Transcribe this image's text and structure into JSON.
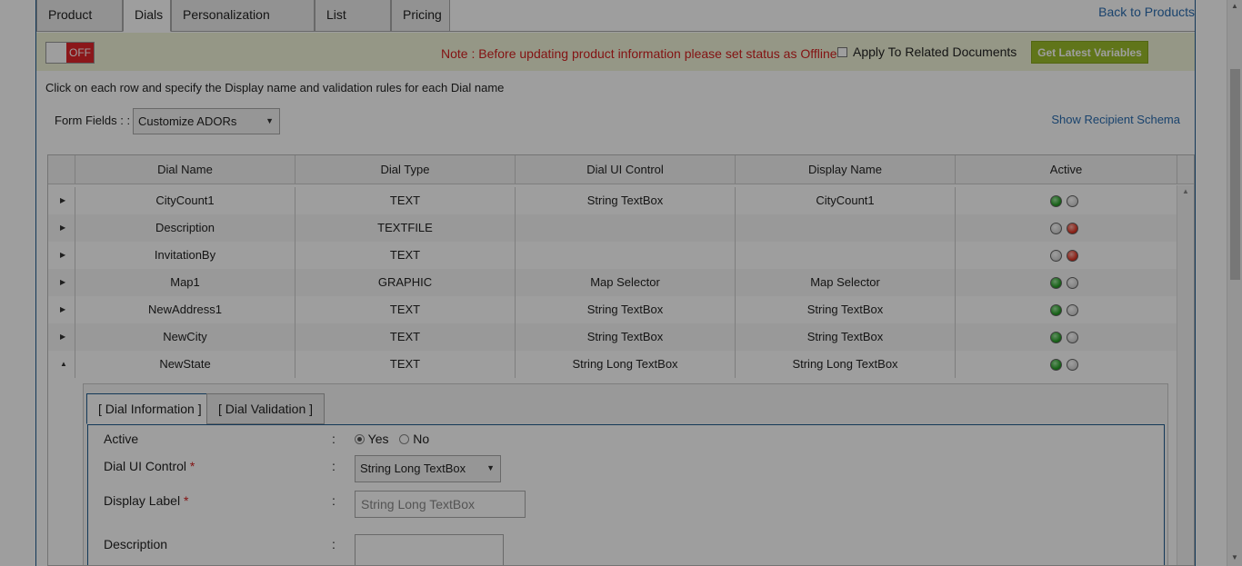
{
  "tabs": [
    {
      "label": "Product Info"
    },
    {
      "label": "Dials"
    },
    {
      "label": "Personalization Wizard"
    },
    {
      "label": "List Types"
    },
    {
      "label": "Pricing"
    }
  ],
  "back_link": "Back to Products",
  "toolbar": {
    "toggle_label": "OFF",
    "note": "Note : Before updating product information please set status as Offline",
    "apply_label": "Apply To Related Documents",
    "latest_button": "Get Latest Variables"
  },
  "instructions": "Click on each row and specify the Display name and validation rules for each Dial name",
  "form_fields": {
    "label": "Form Fields : :",
    "value": "Customize ADORs"
  },
  "schema_link": "Show Recipient Schema",
  "grid": {
    "columns": [
      "Dial Name",
      "Dial Type",
      "Dial UI Control",
      "Display Name",
      "Active"
    ],
    "rows": [
      {
        "name": "CityCount1",
        "type": "TEXT",
        "control": "String TextBox",
        "display": "CityCount1",
        "active": true
      },
      {
        "name": "Description",
        "type": "TEXTFILE",
        "control": "",
        "display": "",
        "active": false
      },
      {
        "name": "InvitationBy",
        "type": "TEXT",
        "control": "",
        "display": "",
        "active": false
      },
      {
        "name": "Map1",
        "type": "GRAPHIC",
        "control": "Map Selector",
        "display": "Map Selector",
        "active": true
      },
      {
        "name": "NewAddress1",
        "type": "TEXT",
        "control": "String TextBox",
        "display": "String TextBox",
        "active": true
      },
      {
        "name": "NewCity",
        "type": "TEXT",
        "control": "String TextBox",
        "display": "String TextBox",
        "active": true
      },
      {
        "name": "NewState",
        "type": "TEXT",
        "control": "String Long TextBox",
        "display": "String Long TextBox",
        "active": true
      }
    ]
  },
  "detail": {
    "tabs": [
      "[ Dial Information ]",
      "[ Dial Validation ]"
    ],
    "active_label": "Active",
    "yes_label": "Yes",
    "no_label": "No",
    "ui_control_label": "Dial UI Control",
    "ui_control_value": "String Long TextBox",
    "display_label_label": "Display Label",
    "display_label_placeholder": "String Long TextBox",
    "description_label": "Description",
    "colon": ":",
    "required_mark": "*"
  }
}
